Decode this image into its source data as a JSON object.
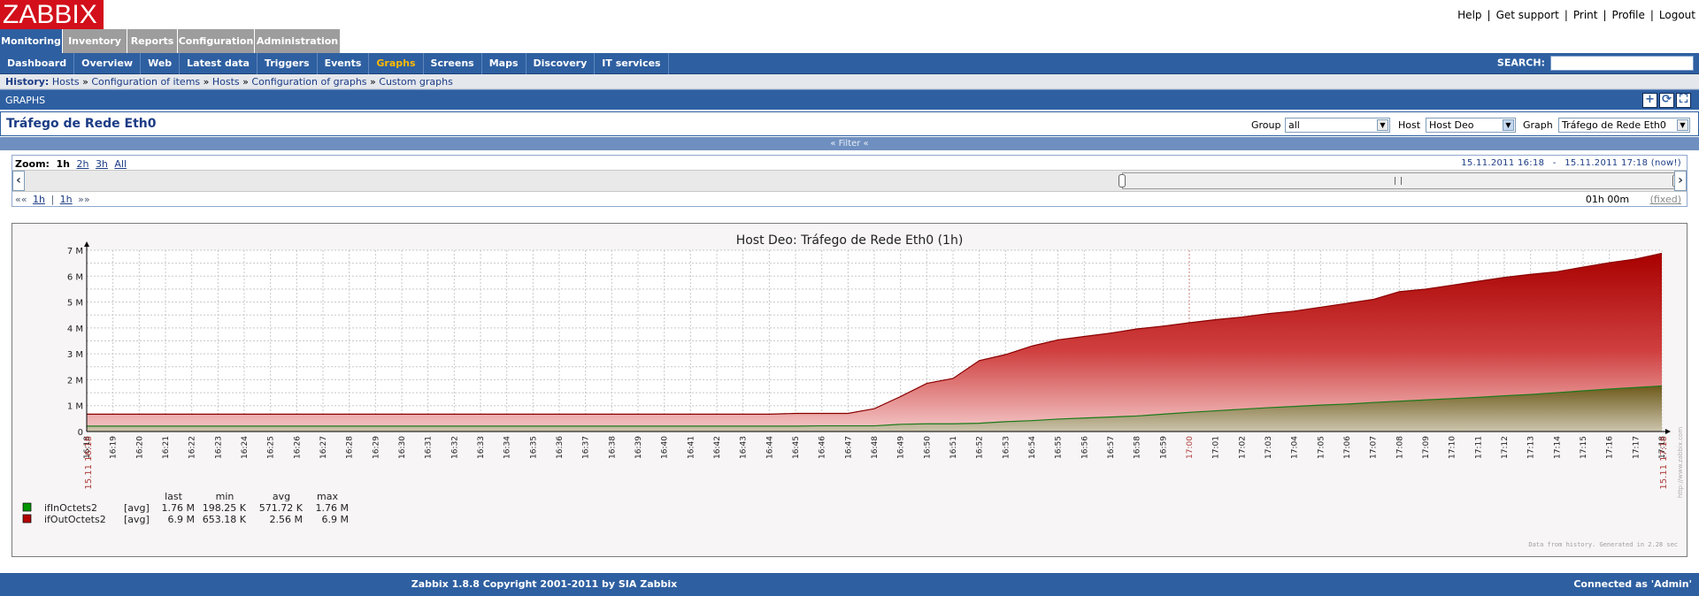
{
  "app": {
    "logo": "ZABBIX",
    "top_links": [
      "Help",
      "Get support",
      "Print",
      "Profile",
      "Logout"
    ]
  },
  "main_menu": [
    {
      "label": "Monitoring",
      "active": true
    },
    {
      "label": "Inventory",
      "active": false
    },
    {
      "label": "Reports",
      "active": false
    },
    {
      "label": "Configuration",
      "active": false
    },
    {
      "label": "Administration",
      "active": false
    }
  ],
  "sub_menu": [
    {
      "label": "Dashboard",
      "active": false
    },
    {
      "label": "Overview",
      "active": false
    },
    {
      "label": "Web",
      "active": false
    },
    {
      "label": "Latest data",
      "active": false
    },
    {
      "label": "Triggers",
      "active": false
    },
    {
      "label": "Events",
      "active": false
    },
    {
      "label": "Graphs",
      "active": true
    },
    {
      "label": "Screens",
      "active": false
    },
    {
      "label": "Maps",
      "active": false
    },
    {
      "label": "Discovery",
      "active": false
    },
    {
      "label": "IT services",
      "active": false
    }
  ],
  "search": {
    "label": "SEARCH:",
    "value": ""
  },
  "history": {
    "label": "History:",
    "items": [
      "Hosts",
      "Configuration of items",
      "Hosts",
      "Configuration of graphs",
      "Custom graphs"
    ],
    "sep": "»"
  },
  "section": {
    "title": "GRAPHS"
  },
  "graph_header": {
    "title": "Tráfego de Rede Eth0",
    "group_label": "Group",
    "group_value": "all",
    "host_label": "Host",
    "host_value": "Host Deo",
    "graph_label": "Graph",
    "graph_value": "Tráfego de Rede Eth0"
  },
  "filter": {
    "label": "« Filter «"
  },
  "timeline": {
    "zoom_label": "Zoom:",
    "zoom_options": [
      "1h",
      "2h",
      "3h",
      "All"
    ],
    "zoom_active": "1h",
    "period_from": "15.11.2011 16:18",
    "period_dash": "-",
    "period_to": "15.11.2011 17:18",
    "period_now": "(now!)",
    "nav_left": "««",
    "nav_1h_a": "1h",
    "nav_sep": "|",
    "nav_1h_b": "1h",
    "nav_right": "»»",
    "duration": "01h 00m",
    "fixed": "(fixed)"
  },
  "chart_data": {
    "type": "area",
    "title": "Host Deo: Tráfego de Rede Eth0  (1h)",
    "x": [
      "16:18",
      "16:19",
      "16:20",
      "16:21",
      "16:22",
      "16:23",
      "16:24",
      "16:25",
      "16:26",
      "16:27",
      "16:28",
      "16:29",
      "16:30",
      "16:31",
      "16:32",
      "16:33",
      "16:34",
      "16:35",
      "16:36",
      "16:37",
      "16:38",
      "16:39",
      "16:40",
      "16:41",
      "16:42",
      "16:43",
      "16:44",
      "16:45",
      "16:46",
      "16:47",
      "16:48",
      "16:49",
      "16:50",
      "16:51",
      "16:52",
      "16:53",
      "16:54",
      "16:55",
      "16:56",
      "16:57",
      "16:58",
      "16:59",
      "17:00",
      "17:01",
      "17:02",
      "17:03",
      "17:04",
      "17:05",
      "17:06",
      "17:07",
      "17:08",
      "17:09",
      "17:10",
      "17:11",
      "17:12",
      "17:13",
      "17:14",
      "17:15",
      "17:16",
      "17:17",
      "17:18"
    ],
    "x_edge_label_start": "15.11 16:18",
    "x_edge_label_end": "15.11 17:18",
    "x_highlight": [
      "17:00"
    ],
    "yticks": [
      "0",
      "1 M",
      "2 M",
      "3 M",
      "4 M",
      "5 M",
      "6 M",
      "7 M"
    ],
    "ylim": [
      0,
      7
    ],
    "yunit": "M",
    "series": [
      {
        "name": "ifOutOctets2",
        "color": "#b20000",
        "values": [
          0.67,
          0.67,
          0.67,
          0.67,
          0.67,
          0.67,
          0.67,
          0.67,
          0.67,
          0.67,
          0.67,
          0.67,
          0.67,
          0.67,
          0.67,
          0.67,
          0.67,
          0.67,
          0.67,
          0.67,
          0.67,
          0.67,
          0.67,
          0.67,
          0.67,
          0.67,
          0.67,
          0.7,
          0.7,
          0.7,
          0.88,
          1.35,
          1.86,
          2.05,
          2.74,
          2.97,
          3.3,
          3.54,
          3.67,
          3.8,
          3.96,
          4.07,
          4.2,
          4.32,
          4.42,
          4.55,
          4.65,
          4.8,
          4.95,
          5.1,
          5.4,
          5.5,
          5.65,
          5.8,
          5.95,
          6.07,
          6.17,
          6.35,
          6.52,
          6.66,
          6.88
        ]
      },
      {
        "name": "ifInOctets2",
        "color": "#009600",
        "values": [
          0.21,
          0.21,
          0.21,
          0.21,
          0.21,
          0.21,
          0.21,
          0.21,
          0.21,
          0.21,
          0.21,
          0.21,
          0.21,
          0.21,
          0.21,
          0.21,
          0.21,
          0.21,
          0.21,
          0.21,
          0.21,
          0.21,
          0.21,
          0.21,
          0.21,
          0.21,
          0.21,
          0.21,
          0.22,
          0.22,
          0.22,
          0.28,
          0.3,
          0.3,
          0.32,
          0.38,
          0.42,
          0.48,
          0.52,
          0.56,
          0.6,
          0.67,
          0.74,
          0.8,
          0.86,
          0.92,
          0.97,
          1.02,
          1.06,
          1.12,
          1.17,
          1.22,
          1.27,
          1.32,
          1.38,
          1.43,
          1.5,
          1.57,
          1.64,
          1.7,
          1.76
        ]
      }
    ],
    "legend": {
      "headers": [
        "last",
        "min",
        "avg",
        "max"
      ],
      "rows": [
        {
          "name": "ifInOctets2",
          "func": "[avg]",
          "last": "1.76 M",
          "min": "198.25 K",
          "avg": "571.72 K",
          "max": "1.76 M",
          "color": "#009600"
        },
        {
          "name": "ifOutOctets2",
          "func": "[avg]",
          "last": "6.9 M",
          "min": "653.18 K",
          "avg": "2.56 M",
          "max": "6.9 M",
          "color": "#b20000"
        }
      ]
    },
    "side_watermark": "http://www.zabbix.com",
    "footnote": "Data from history. Generated in 2.28 sec"
  },
  "footer": {
    "copyright": "Zabbix 1.8.8 Copyright 2001-2011 by SIA Zabbix",
    "connected": "Connected as 'Admin'"
  }
}
